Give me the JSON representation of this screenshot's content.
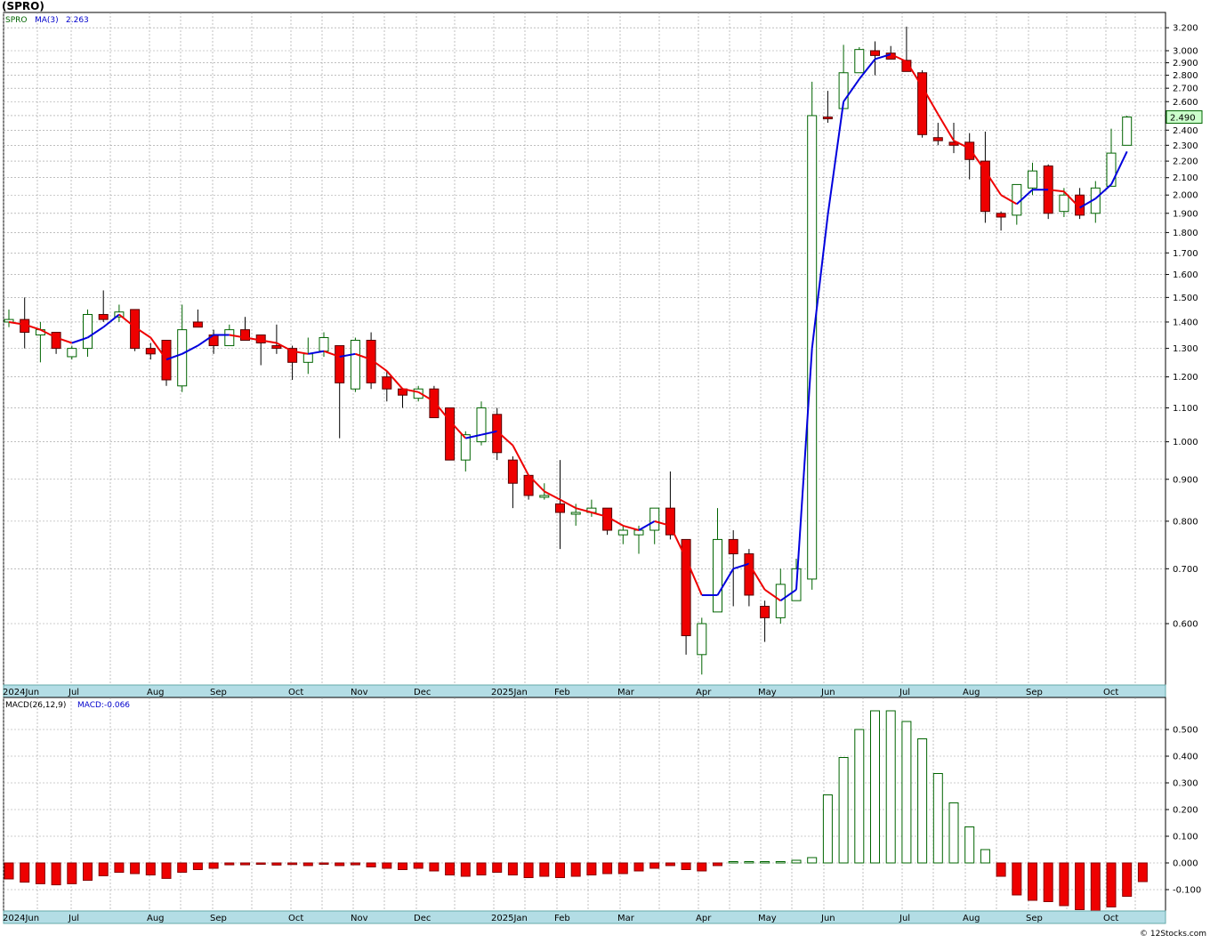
{
  "chart_data": [
    {
      "type": "candlestick",
      "title": "(SPRO)",
      "ticker_label": "SPRO",
      "indicator_label": "MA(3)",
      "indicator_value": "2.263",
      "last_price_label": "2.490",
      "y_scale": "log",
      "ylim": [
        0.5,
        3.3
      ],
      "y_ticks": [
        "3.200",
        "3.000",
        "2.900",
        "2.800",
        "2.700",
        "2.600",
        "2.500",
        "2.400",
        "2.300",
        "2.200",
        "2.100",
        "2.000",
        "1.900",
        "1.800",
        "1.700",
        "1.600",
        "1.500",
        "1.400",
        "1.300",
        "1.200",
        "1.100",
        "1.000",
        "0.900",
        "0.800",
        "0.700",
        "0.600"
      ],
      "x_month_labels": [
        "2024Jun",
        "Jul",
        "Aug",
        "Sep",
        "Oct",
        "Nov",
        "Dec",
        "2025Jan",
        "Feb",
        "Mar",
        "Apr",
        "May",
        "Jun",
        "Jul",
        "Aug",
        "Sep",
        "Oct"
      ],
      "grid": true,
      "colors": {
        "up": "#ffffff",
        "up_border": "#006400",
        "down": "#ee0000",
        "ma_up": "#0000dd",
        "ma_down": "#ee0000"
      },
      "candles": [
        {
          "o": 1.4,
          "h": 1.45,
          "l": 1.38,
          "c": 1.41
        },
        {
          "o": 1.41,
          "h": 1.5,
          "l": 1.3,
          "c": 1.36
        },
        {
          "o": 1.35,
          "h": 1.4,
          "l": 1.25,
          "c": 1.37
        },
        {
          "o": 1.36,
          "h": 1.36,
          "l": 1.28,
          "c": 1.3
        },
        {
          "o": 1.27,
          "h": 1.31,
          "l": 1.26,
          "c": 1.3
        },
        {
          "o": 1.3,
          "h": 1.45,
          "l": 1.27,
          "c": 1.43
        },
        {
          "o": 1.43,
          "h": 1.53,
          "l": 1.4,
          "c": 1.41
        },
        {
          "o": 1.42,
          "h": 1.47,
          "l": 1.4,
          "c": 1.44
        },
        {
          "o": 1.45,
          "h": 1.45,
          "l": 1.29,
          "c": 1.3
        },
        {
          "o": 1.3,
          "h": 1.32,
          "l": 1.26,
          "c": 1.28
        },
        {
          "o": 1.33,
          "h": 1.33,
          "l": 1.17,
          "c": 1.19
        },
        {
          "o": 1.17,
          "h": 1.47,
          "l": 1.15,
          "c": 1.37
        },
        {
          "o": 1.4,
          "h": 1.45,
          "l": 1.38,
          "c": 1.38
        },
        {
          "o": 1.35,
          "h": 1.37,
          "l": 1.28,
          "c": 1.31
        },
        {
          "o": 1.31,
          "h": 1.39,
          "l": 1.31,
          "c": 1.37
        },
        {
          "o": 1.37,
          "h": 1.42,
          "l": 1.33,
          "c": 1.33
        },
        {
          "o": 1.35,
          "h": 1.35,
          "l": 1.24,
          "c": 1.32
        },
        {
          "o": 1.31,
          "h": 1.39,
          "l": 1.28,
          "c": 1.3
        },
        {
          "o": 1.3,
          "h": 1.31,
          "l": 1.19,
          "c": 1.25
        },
        {
          "o": 1.25,
          "h": 1.34,
          "l": 1.21,
          "c": 1.28
        },
        {
          "o": 1.29,
          "h": 1.36,
          "l": 1.27,
          "c": 1.34
        },
        {
          "o": 1.31,
          "h": 1.31,
          "l": 1.01,
          "c": 1.18
        },
        {
          "o": 1.16,
          "h": 1.34,
          "l": 1.15,
          "c": 1.33
        },
        {
          "o": 1.33,
          "h": 1.36,
          "l": 1.16,
          "c": 1.18
        },
        {
          "o": 1.2,
          "h": 1.22,
          "l": 1.12,
          "c": 1.16
        },
        {
          "o": 1.16,
          "h": 1.16,
          "l": 1.1,
          "c": 1.14
        },
        {
          "o": 1.13,
          "h": 1.17,
          "l": 1.12,
          "c": 1.16
        },
        {
          "o": 1.16,
          "h": 1.17,
          "l": 1.07,
          "c": 1.07
        },
        {
          "o": 1.1,
          "h": 1.1,
          "l": 0.95,
          "c": 0.95
        },
        {
          "o": 0.95,
          "h": 1.03,
          "l": 0.92,
          "c": 1.02
        },
        {
          "o": 1.0,
          "h": 1.12,
          "l": 0.99,
          "c": 1.1
        },
        {
          "o": 1.08,
          "h": 1.1,
          "l": 0.95,
          "c": 0.97
        },
        {
          "o": 0.95,
          "h": 0.96,
          "l": 0.83,
          "c": 0.89
        },
        {
          "o": 0.91,
          "h": 0.91,
          "l": 0.85,
          "c": 0.86
        },
        {
          "o": 0.86,
          "h": 0.89,
          "l": 0.85,
          "c": 0.86
        },
        {
          "o": 0.84,
          "h": 0.95,
          "l": 0.74,
          "c": 0.82
        },
        {
          "o": 0.82,
          "h": 0.84,
          "l": 0.79,
          "c": 0.82
        },
        {
          "o": 0.82,
          "h": 0.85,
          "l": 0.81,
          "c": 0.83
        },
        {
          "o": 0.83,
          "h": 0.83,
          "l": 0.77,
          "c": 0.78
        },
        {
          "o": 0.77,
          "h": 0.79,
          "l": 0.75,
          "c": 0.78
        },
        {
          "o": 0.77,
          "h": 0.79,
          "l": 0.73,
          "c": 0.78
        },
        {
          "o": 0.78,
          "h": 0.83,
          "l": 0.75,
          "c": 0.83
        },
        {
          "o": 0.83,
          "h": 0.92,
          "l": 0.76,
          "c": 0.77
        },
        {
          "o": 0.76,
          "h": 0.76,
          "l": 0.55,
          "c": 0.58
        },
        {
          "o": 0.55,
          "h": 0.61,
          "l": 0.52,
          "c": 0.6
        },
        {
          "o": 0.62,
          "h": 0.83,
          "l": 0.62,
          "c": 0.76
        },
        {
          "o": 0.76,
          "h": 0.78,
          "l": 0.63,
          "c": 0.73
        },
        {
          "o": 0.73,
          "h": 0.74,
          "l": 0.63,
          "c": 0.65
        },
        {
          "o": 0.63,
          "h": 0.64,
          "l": 0.57,
          "c": 0.61
        },
        {
          "o": 0.61,
          "h": 0.7,
          "l": 0.6,
          "c": 0.67
        },
        {
          "o": 0.64,
          "h": 0.72,
          "l": 0.64,
          "c": 0.7
        },
        {
          "o": 0.68,
          "h": 2.75,
          "l": 0.66,
          "c": 2.5
        },
        {
          "o": 2.49,
          "h": 2.68,
          "l": 2.45,
          "c": 2.48
        },
        {
          "o": 2.55,
          "h": 3.05,
          "l": 2.55,
          "c": 2.82
        },
        {
          "o": 2.82,
          "h": 3.03,
          "l": 2.82,
          "c": 3.01
        },
        {
          "o": 3.0,
          "h": 3.08,
          "l": 2.8,
          "c": 2.96
        },
        {
          "o": 2.98,
          "h": 3.04,
          "l": 2.93,
          "c": 2.93
        },
        {
          "o": 2.92,
          "h": 3.21,
          "l": 2.86,
          "c": 2.83
        },
        {
          "o": 2.82,
          "h": 2.84,
          "l": 2.35,
          "c": 2.37
        },
        {
          "o": 2.35,
          "h": 2.45,
          "l": 2.3,
          "c": 2.33
        },
        {
          "o": 2.32,
          "h": 2.45,
          "l": 2.25,
          "c": 2.3
        },
        {
          "o": 2.32,
          "h": 2.38,
          "l": 2.09,
          "c": 2.21
        },
        {
          "o": 2.2,
          "h": 2.39,
          "l": 1.85,
          "c": 1.91
        },
        {
          "o": 1.9,
          "h": 1.91,
          "l": 1.81,
          "c": 1.88
        },
        {
          "o": 1.89,
          "h": 2.05,
          "l": 1.84,
          "c": 2.06
        },
        {
          "o": 2.04,
          "h": 2.19,
          "l": 2.0,
          "c": 2.14
        },
        {
          "o": 2.17,
          "h": 2.18,
          "l": 1.87,
          "c": 1.9
        },
        {
          "o": 1.91,
          "h": 2.04,
          "l": 1.88,
          "c": 2.0
        },
        {
          "o": 2.0,
          "h": 2.04,
          "l": 1.87,
          "c": 1.89
        },
        {
          "o": 1.9,
          "h": 2.08,
          "l": 1.85,
          "c": 2.04
        },
        {
          "o": 2.05,
          "h": 2.41,
          "l": 2.05,
          "c": 2.25
        },
        {
          "o": 2.3,
          "h": 2.5,
          "l": 2.3,
          "c": 2.49
        }
      ],
      "ma3": [
        1.4,
        1.39,
        1.37,
        1.34,
        1.32,
        1.34,
        1.38,
        1.43,
        1.38,
        1.34,
        1.26,
        1.28,
        1.31,
        1.35,
        1.35,
        1.34,
        1.33,
        1.32,
        1.29,
        1.28,
        1.29,
        1.27,
        1.28,
        1.26,
        1.22,
        1.16,
        1.15,
        1.12,
        1.06,
        1.01,
        1.02,
        1.03,
        0.99,
        0.91,
        0.87,
        0.85,
        0.83,
        0.82,
        0.81,
        0.79,
        0.78,
        0.8,
        0.79,
        0.72,
        0.65,
        0.65,
        0.7,
        0.71,
        0.66,
        0.64,
        0.66,
        1.3,
        1.89,
        2.6,
        2.77,
        2.93,
        2.97,
        2.91,
        2.71,
        2.51,
        2.33,
        2.28,
        2.14,
        2.0,
        1.95,
        2.03,
        2.03,
        2.02,
        1.93,
        1.98,
        2.06,
        2.26
      ]
    },
    {
      "type": "bar",
      "title": "MACD(26,12,9)",
      "indicator_label": "MACD(26,12,9)",
      "indicator_value": "MACD:-0.066",
      "ylim": [
        -0.18,
        0.58
      ],
      "y_ticks": [
        "0.500",
        "0.400",
        "0.300",
        "0.200",
        "0.100",
        "0.000",
        "-0.100"
      ],
      "x_month_labels": [
        "2024Jun",
        "Jul",
        "Aug",
        "Sep",
        "Oct",
        "Nov",
        "Dec",
        "2025Jan",
        "Feb",
        "Mar",
        "Apr",
        "May",
        "Jun",
        "Jul",
        "Aug",
        "Sep",
        "Oct"
      ],
      "grid": true,
      "values": [
        -0.06,
        -0.072,
        -0.078,
        -0.082,
        -0.078,
        -0.065,
        -0.048,
        -0.035,
        -0.04,
        -0.045,
        -0.058,
        -0.035,
        -0.025,
        -0.02,
        -0.007,
        -0.007,
        -0.005,
        -0.008,
        -0.006,
        -0.01,
        -0.005,
        -0.01,
        -0.007,
        -0.015,
        -0.02,
        -0.025,
        -0.02,
        -0.03,
        -0.045,
        -0.05,
        -0.045,
        -0.035,
        -0.045,
        -0.055,
        -0.05,
        -0.055,
        -0.05,
        -0.045,
        -0.04,
        -0.04,
        -0.03,
        -0.02,
        -0.01,
        -0.025,
        -0.03,
        -0.01,
        0.005,
        0.005,
        0.005,
        0.005,
        0.01,
        0.02,
        0.255,
        0.395,
        0.5,
        0.57,
        0.57,
        0.53,
        0.465,
        0.335,
        0.225,
        0.135,
        0.05,
        -0.05,
        -0.12,
        -0.14,
        -0.145,
        -0.16,
        -0.175,
        -0.185,
        -0.165,
        -0.125,
        -0.07
      ]
    }
  ],
  "footer": {
    "copyright": "© 12Stocks.com"
  }
}
